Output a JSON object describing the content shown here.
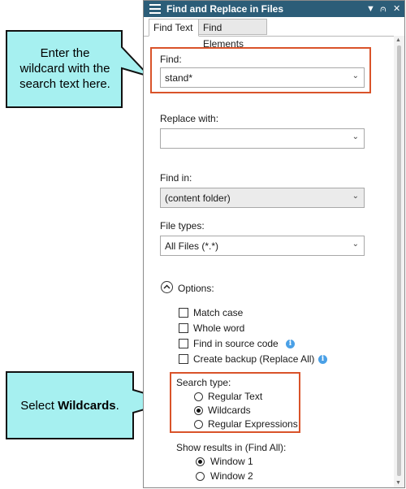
{
  "panel": {
    "title": "Find and Replace in Files",
    "controls": {
      "menu": "▼",
      "pin": "⩀",
      "close": "✕"
    }
  },
  "tabs": [
    {
      "label": "Find Text"
    },
    {
      "label": "Find Elements"
    }
  ],
  "find": {
    "label": "Find:",
    "value": "stand*"
  },
  "replace": {
    "label": "Replace with:",
    "value": ""
  },
  "find_in": {
    "label": "Find in:",
    "value": "(content folder)"
  },
  "file_types": {
    "label": "File types:",
    "value": "All Files (*.*)"
  },
  "options": {
    "label": "Options:",
    "checkboxes": [
      {
        "label": "Match case",
        "checked": false
      },
      {
        "label": "Whole word",
        "checked": false
      },
      {
        "label": "Find in source code",
        "checked": false
      },
      {
        "label": "Create backup (Replace All)",
        "checked": false
      }
    ]
  },
  "search_type": {
    "label": "Search type:",
    "options": [
      {
        "label": "Regular Text",
        "selected": false
      },
      {
        "label": "Wildcards",
        "selected": true
      },
      {
        "label": "Regular Expressions",
        "selected": false
      }
    ]
  },
  "show_results": {
    "label": "Show results in (Find All):",
    "options": [
      {
        "label": "Window 1",
        "selected": true
      },
      {
        "label": "Window 2",
        "selected": false
      }
    ]
  },
  "callouts": {
    "top": {
      "line1": "Enter the",
      "line2": "wildcard with the",
      "line3": "search text here."
    },
    "bottom": {
      "prefix": "Select ",
      "bold": "Wildcards",
      "suffix": "."
    }
  },
  "colors": {
    "titlebar": "#2c5d78",
    "callout_fill": "#a6f0f0",
    "highlight_border": "#d9532a",
    "info_icon": "#4aa0e6"
  }
}
